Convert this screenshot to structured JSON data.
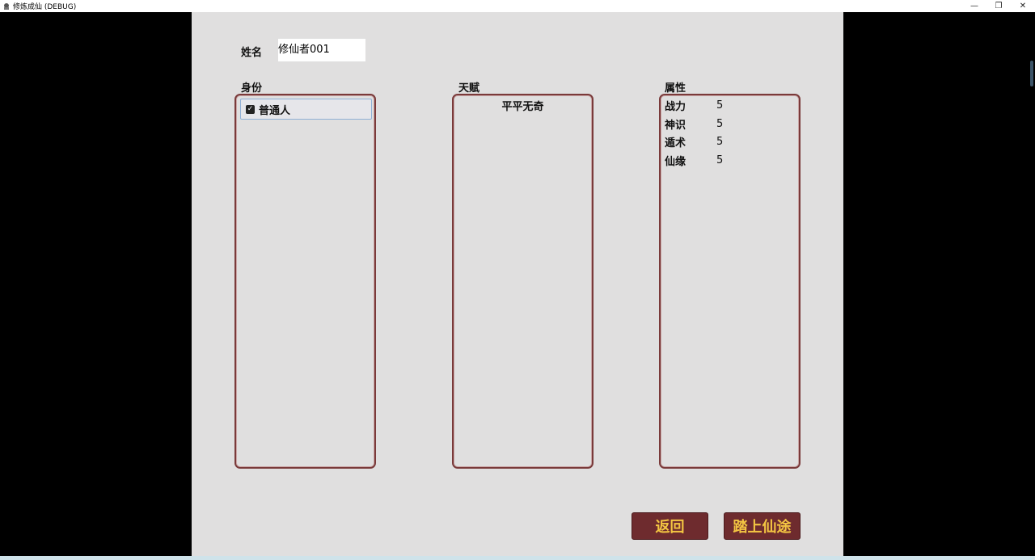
{
  "window": {
    "title": "修炼成仙 (DEBUG)",
    "icon": "app-icon",
    "controls": [
      "minimize-icon",
      "restore-icon",
      "close-icon"
    ]
  },
  "form": {
    "name_label": "姓名",
    "name_value": "修仙者001",
    "identity_label": "身份",
    "talent_label": "天赋",
    "attributes_label": "属性"
  },
  "identity": {
    "items": [
      {
        "label": "普通人",
        "checked": true
      }
    ]
  },
  "talent": {
    "text": "平平无奇"
  },
  "attributes": [
    {
      "name": "战力",
      "value": "5"
    },
    {
      "name": "神识",
      "value": "5"
    },
    {
      "name": "遁术",
      "value": "5"
    },
    {
      "name": "仙缘",
      "value": "5"
    }
  ],
  "buttons": {
    "back": "返回",
    "start": "踏上仙途"
  },
  "colors": {
    "panel_border": "#7a3a3a",
    "button_bg": "#6e2b2e",
    "button_text": "#f3c542",
    "stage_bg": "#e0dfdf"
  }
}
